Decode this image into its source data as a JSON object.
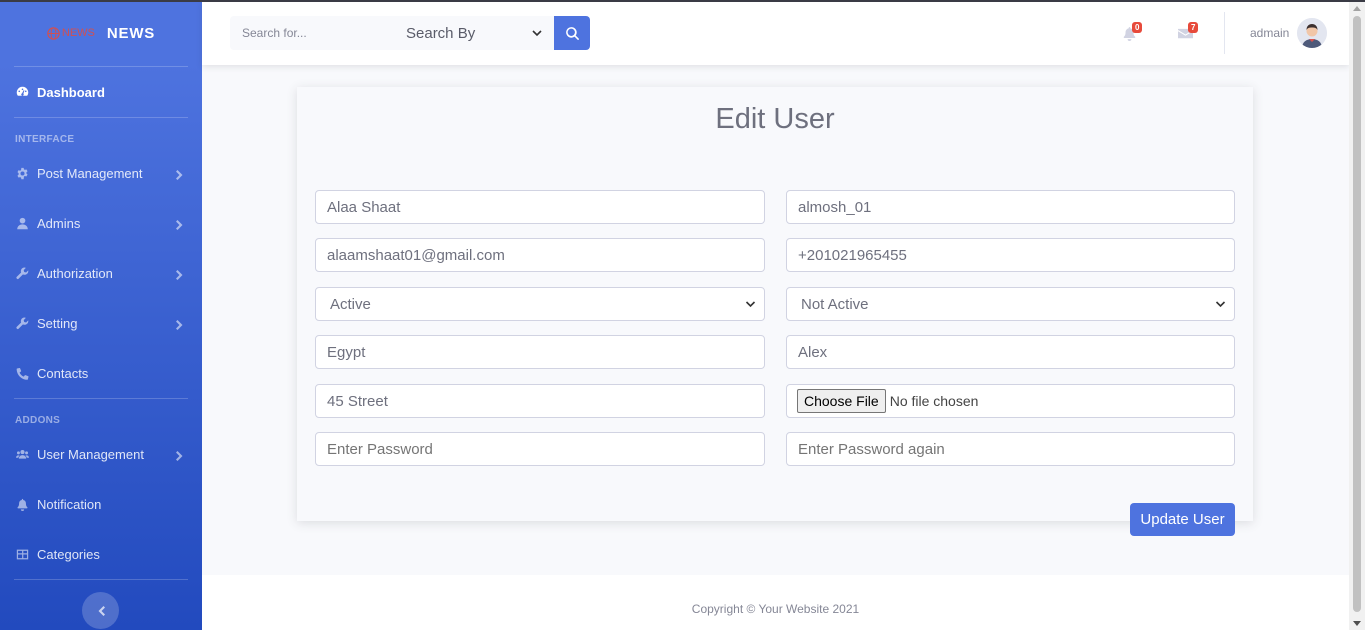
{
  "brand": {
    "logo_text": "NEWS",
    "name": "NEWS"
  },
  "sidebar": {
    "dashboard": "Dashboard",
    "heading_interface": "INTERFACE",
    "post_management": "Post Management",
    "admins": "Admins",
    "authorization": "Authorization",
    "setting": "Setting",
    "contacts": "Contacts",
    "heading_addons": "ADDONS",
    "user_management": "User Management",
    "notification": "Notification",
    "categories": "Categories"
  },
  "topbar": {
    "search_placeholder": "Search for...",
    "search_by": "Search By",
    "alerts_count": "0",
    "messages_count": "7",
    "user_name": "admain"
  },
  "form": {
    "title": "Edit User",
    "name": "Alaa Shaat",
    "username": "almosh_01",
    "email": "alaamshaat01@gmail.com",
    "phone": "+201021965455",
    "status": "Active",
    "email_status": "Not Active",
    "country": "Egypt",
    "city": "Alex",
    "street": "45 Street",
    "file_button": "Choose File",
    "file_text": "No file chosen",
    "password_placeholder": "Enter Password",
    "password_confirm_placeholder": "Enter Password again",
    "submit": "Update User"
  },
  "footer": {
    "copyright": "Copyright © Your Website 2021"
  },
  "colors": {
    "primary": "#4e73df",
    "danger": "#e74a3b",
    "muted": "#858796"
  }
}
